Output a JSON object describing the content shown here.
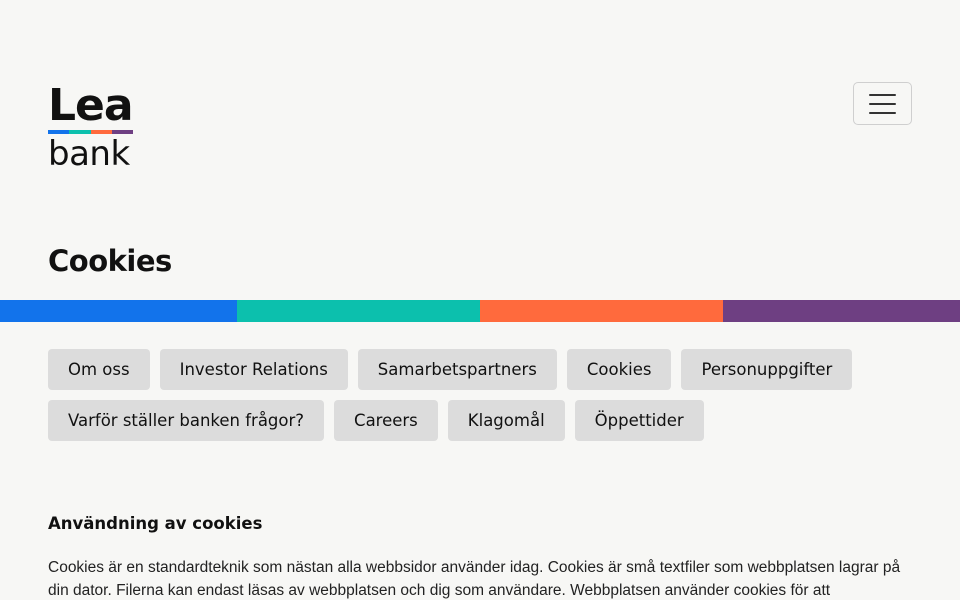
{
  "logo": {
    "top": "Lea",
    "bottom": "bank",
    "stripe_colors": [
      "#1273eb",
      "#0cc0ad",
      "#ff6a3d",
      "#6e3f82"
    ]
  },
  "header": {
    "menu_icon": "hamburger-menu-icon"
  },
  "page": {
    "title": "Cookies"
  },
  "color_bar": {
    "colors": [
      "#1273eb",
      "#0cc0ad",
      "#ff6a3d",
      "#6e3f82"
    ]
  },
  "nav_tags": [
    "Om oss",
    "Investor Relations",
    "Samarbetspartners",
    "Cookies",
    "Personuppgifter",
    "Varför ställer banken frågor?",
    "Careers",
    "Klagomål",
    "Öppettider"
  ],
  "content": {
    "heading": "Användning av cookies",
    "paragraph": "Cookies är en standardteknik som nästan alla webbsidor använder idag. Cookies är små textfiler som webbplatsen lagrar på din dator. Filerna kan endast läsas av webbplatsen och dig som användare. Webbplatsen använder cookies för att"
  }
}
